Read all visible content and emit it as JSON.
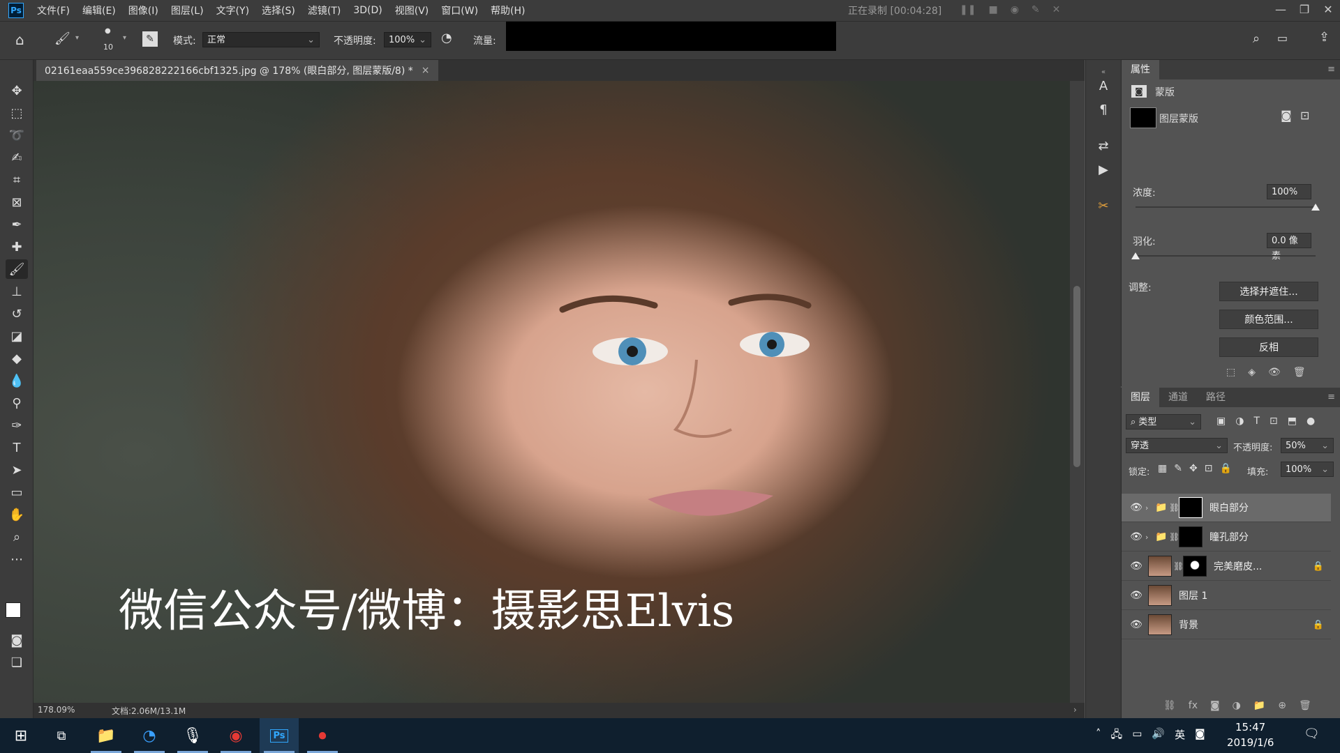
{
  "menubar": {
    "items": [
      "文件(F)",
      "编辑(E)",
      "图像(I)",
      "图层(L)",
      "文字(Y)",
      "选择(S)",
      "滤镜(T)",
      "3D(D)",
      "视图(V)",
      "窗口(W)",
      "帮助(H)"
    ],
    "recording_status": "正在录制 [00:04:28]"
  },
  "options": {
    "brush_size": "10",
    "mode_label": "模式:",
    "mode_value": "正常",
    "opacity_label": "不透明度:",
    "opacity_value": "100%",
    "flow_label": "流量:"
  },
  "document": {
    "tab_title": "02161eaa559ce396828222166cbf1325.jpg @ 178% (眼白部分, 图层蒙版/8) *",
    "close": "×",
    "zoom": "178.09%",
    "doc_info": "文档:2.06M/13.1M"
  },
  "watermark": "微信公众号/微博：摄影思Elvis",
  "properties": {
    "tab": "属性",
    "section": "蒙版",
    "mask_type": "图层蒙版",
    "density_label": "浓度:",
    "density_value": "100%",
    "density_fraction": 1.0,
    "feather_label": "羽化:",
    "feather_value": "0.0 像素",
    "feather_fraction": 0.0,
    "adjust_label": "调整:",
    "btn_select_mask": "选择并遮住...",
    "btn_color_range": "颜色范围...",
    "btn_invert": "反相"
  },
  "layers_panel": {
    "tabs": [
      "图层",
      "通道",
      "路径"
    ],
    "filter_label": "类型",
    "blend_mode": "穿透",
    "opacity_label": "不透明度:",
    "opacity_value": "50%",
    "lock_label": "锁定:",
    "fill_label": "填充:",
    "fill_value": "100%",
    "layers": [
      {
        "name": "眼白部分",
        "kind": "group",
        "selected": true,
        "locked": false
      },
      {
        "name": "瞳孔部分",
        "kind": "group",
        "selected": false,
        "locked": false
      },
      {
        "name": "完美磨皮...",
        "kind": "smart",
        "selected": false,
        "locked": true
      },
      {
        "name": "图层 1",
        "kind": "pixel",
        "selected": false,
        "locked": false
      },
      {
        "name": "背景",
        "kind": "pixel",
        "selected": false,
        "locked": true
      }
    ]
  },
  "taskbar": {
    "ime": "英",
    "time": "15:47",
    "date": "2019/1/6"
  },
  "colors": {
    "ui_dark": "#3c3c3c",
    "ui_mid": "#535353",
    "accent_ps": "#31a8ff",
    "taskbar": "#0f1f2e"
  }
}
